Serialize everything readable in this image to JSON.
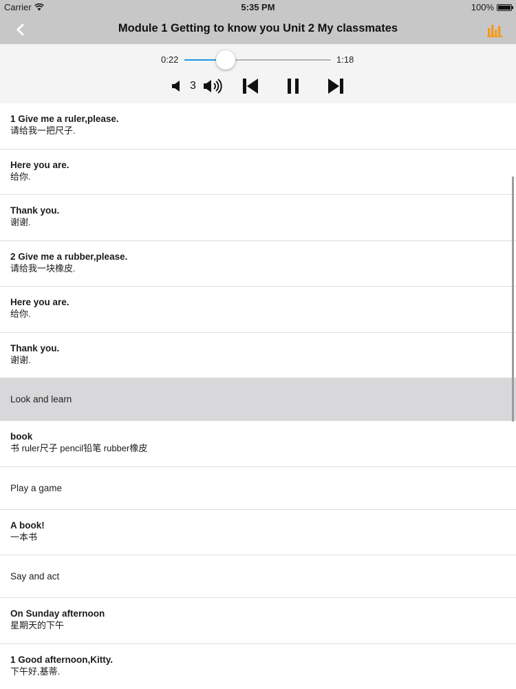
{
  "status_bar": {
    "carrier": "Carrier",
    "time": "5:35 PM",
    "battery_percent": "100%"
  },
  "nav": {
    "title": "Module 1 Getting to know you Unit 2 My classmates",
    "back_icon": "chevron-left-icon",
    "chart_icon": "bar-chart-icon",
    "accent_color": "#f39a1e"
  },
  "player": {
    "current_time": "0:22",
    "total_time": "1:18",
    "progress_fraction": 0.282,
    "volume_level": "3",
    "track_color": "#1b95e0",
    "controls": [
      "volume-down-icon",
      "volume-up-icon",
      "skip-previous-icon",
      "pause-icon",
      "skip-next-icon"
    ]
  },
  "rows": [
    {
      "type": "dialog",
      "en": "1 Give me a ruler,please.",
      "cn": "请给我一把尺子."
    },
    {
      "type": "dialog",
      "en": "Here you are.",
      "cn": "给你."
    },
    {
      "type": "dialog",
      "en": "Thank you.",
      "cn": "谢谢."
    },
    {
      "type": "dialog",
      "en": "2 Give me a rubber,please.",
      "cn": "请给我一块橡皮."
    },
    {
      "type": "dialog",
      "en": "Here you are.",
      "cn": "给你."
    },
    {
      "type": "dialog",
      "en": "Thank you.",
      "cn": "谢谢."
    },
    {
      "type": "section",
      "label": "Look and learn",
      "highlight": true
    },
    {
      "type": "dialog",
      "en": "book",
      "cn": "书  ruler尺子  pencil铅笔   rubber橡皮"
    },
    {
      "type": "section",
      "label": "Play a game"
    },
    {
      "type": "dialog",
      "en": "A book!",
      "cn": "一本书"
    },
    {
      "type": "section",
      "label": "Say and act"
    },
    {
      "type": "dialog",
      "en": "On Sunday afternoon",
      "cn": "星期天的下午"
    },
    {
      "type": "dialog",
      "en": "1 Good afternoon,Kitty.",
      "cn": "下午好,基蒂."
    }
  ]
}
